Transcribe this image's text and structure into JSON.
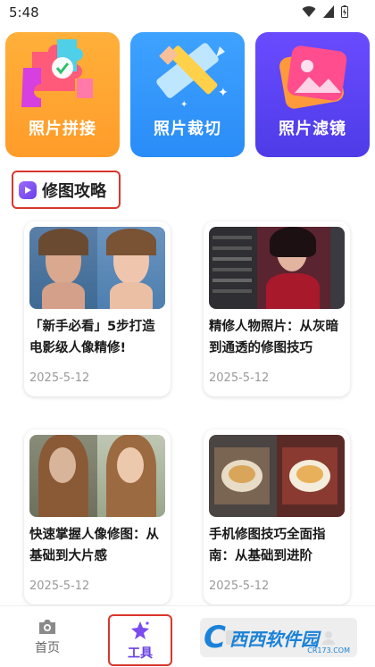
{
  "status_bar": {
    "time": "5:48"
  },
  "tools": [
    {
      "label": "照片拼接",
      "icon": "puzzle-icon"
    },
    {
      "label": "照片裁切",
      "icon": "pencil-ruler-icon"
    },
    {
      "label": "照片滤镜",
      "icon": "image-filter-icon"
    }
  ],
  "section": {
    "title": "修图攻略"
  },
  "articles": [
    {
      "title": "「新手必看」5步打造电影级人像精修!",
      "date": "2025-5-12"
    },
    {
      "title": "精修人物照片：从灰暗到通透的修图技巧",
      "date": "2025-5-12"
    },
    {
      "title": "快速掌握人像修图：从基础到大片感",
      "date": "2025-5-12"
    },
    {
      "title": "手机修图技巧全面指南：从基础到进阶",
      "date": "2025-5-12"
    }
  ],
  "nav": {
    "home": "首页",
    "tools": "工具",
    "third": "",
    "fourth": ""
  },
  "watermark": {
    "brand": "西西软件园",
    "sub": "CR173.COM"
  },
  "colors": {
    "accent": "#6a3fe6",
    "highlight_border": "#d9362c"
  }
}
